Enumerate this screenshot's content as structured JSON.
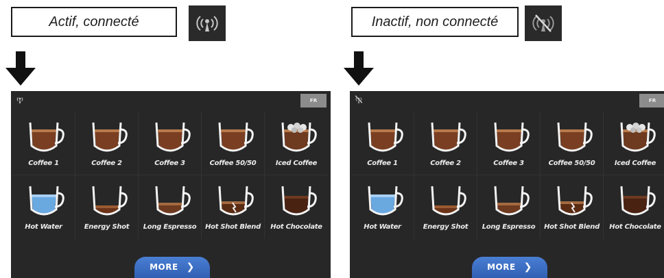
{
  "left": {
    "caption": "Actif, connecté",
    "language": "FR",
    "more_label": "MORE",
    "status": "connected"
  },
  "right": {
    "caption": "Inactif, non connecté",
    "language": "FR",
    "more_label": "MORE",
    "status": "disconnected"
  },
  "drinks": [
    {
      "label": "Coffee 1",
      "kind": "coffee"
    },
    {
      "label": "Coffee 2",
      "kind": "coffee"
    },
    {
      "label": "Coffee 3",
      "kind": "coffee"
    },
    {
      "label": "Coffee 50/50",
      "kind": "coffee"
    },
    {
      "label": "Iced Coffee",
      "kind": "iced"
    },
    {
      "label": "Hot Water",
      "kind": "water"
    },
    {
      "label": "Energy Shot",
      "kind": "shot"
    },
    {
      "label": "Long Espresso",
      "kind": "long"
    },
    {
      "label": "Hot Shot Blend",
      "kind": "blend"
    },
    {
      "label": "Hot Chocolate",
      "kind": "chocolate"
    }
  ],
  "colors": {
    "panel_bg": "#272727",
    "more_button": "#3b6cc4",
    "language_button": "#8c8c8c"
  }
}
